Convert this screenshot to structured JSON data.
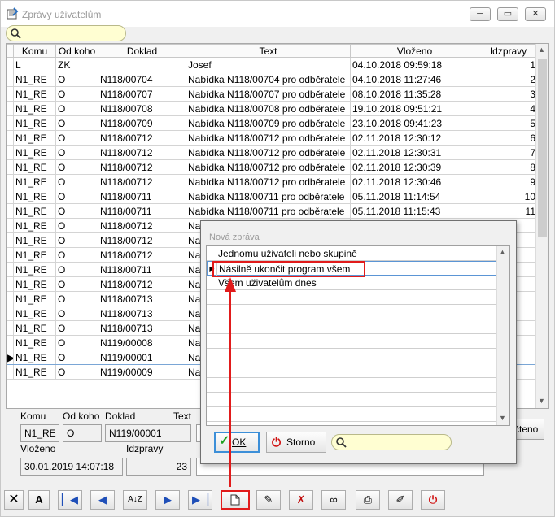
{
  "window": {
    "title": "Zprávy uživatelům"
  },
  "columns": [
    "Komu",
    "Od koho",
    "Doklad",
    "Text",
    "Vloženo",
    "Idzpravy"
  ],
  "rows": [
    [
      "L",
      "ZK",
      "",
      "Josef",
      "04.10.2018 09:59:18",
      "1"
    ],
    [
      "N1_RE",
      "O",
      "N118/00704",
      "Nabídka N118/00704 pro odběratele",
      "04.10.2018 11:27:46",
      "2"
    ],
    [
      "N1_RE",
      "O",
      "N118/00707",
      "Nabídka N118/00707 pro odběratele",
      "08.10.2018 11:35:28",
      "3"
    ],
    [
      "N1_RE",
      "O",
      "N118/00708",
      "Nabídka N118/00708 pro odběratele",
      "19.10.2018 09:51:21",
      "4"
    ],
    [
      "N1_RE",
      "O",
      "N118/00709",
      "Nabídka N118/00709 pro odběratele",
      "23.10.2018 09:41:23",
      "5"
    ],
    [
      "N1_RE",
      "O",
      "N118/00712",
      "Nabídka N118/00712 pro odběratele",
      "02.11.2018 12:30:12",
      "6"
    ],
    [
      "N1_RE",
      "O",
      "N118/00712",
      "Nabídka N118/00712 pro odběratele",
      "02.11.2018 12:30:31",
      "7"
    ],
    [
      "N1_RE",
      "O",
      "N118/00712",
      "Nabídka N118/00712 pro odběratele",
      "02.11.2018 12:30:39",
      "8"
    ],
    [
      "N1_RE",
      "O",
      "N118/00712",
      "Nabídka N118/00712 pro odběratele",
      "02.11.2018 12:30:46",
      "9"
    ],
    [
      "N1_RE",
      "O",
      "N118/00711",
      "Nabídka N118/00711 pro odběratele",
      "05.11.2018 11:14:54",
      "10"
    ],
    [
      "N1_RE",
      "O",
      "N118/00711",
      "Nabídka N118/00711 pro odběratele",
      "05.11.2018 11:15:43",
      "11"
    ],
    [
      "N1_RE",
      "O",
      "N118/00712",
      "Na",
      "",
      ""
    ],
    [
      "N1_RE",
      "O",
      "N118/00712",
      "Na",
      "",
      ""
    ],
    [
      "N1_RE",
      "O",
      "N118/00712",
      "Na",
      "",
      ""
    ],
    [
      "N1_RE",
      "O",
      "N118/00711",
      "Na",
      "",
      ""
    ],
    [
      "N1_RE",
      "O",
      "N118/00712",
      "Na",
      "",
      ""
    ],
    [
      "N1_RE",
      "O",
      "N118/00713",
      "Na",
      "",
      ""
    ],
    [
      "N1_RE",
      "O",
      "N118/00713",
      "Na",
      "",
      ""
    ],
    [
      "N1_RE",
      "O",
      "N118/00713",
      "Na",
      "",
      ""
    ],
    [
      "N1_RE",
      "O",
      "N119/00008",
      "Na",
      "",
      ""
    ],
    [
      "N1_RE",
      "O",
      "N119/00001",
      "Na",
      "",
      ""
    ],
    [
      "N1_RE",
      "O",
      "N119/00009",
      "Na",
      "",
      ""
    ]
  ],
  "selected_row_index": 20,
  "detail": {
    "label_komu": "Komu",
    "label_odkoho": "Od koho",
    "label_doklad": "Doklad",
    "label_text": "Text",
    "komu": "N1_RE",
    "odkoho": "O",
    "doklad": "N119/00001",
    "label_vlozeno": "Vloženo",
    "label_idzpravy": "Idzpravy",
    "vlozeno": "30.01.2019 14:07:18",
    "idzpravy": "23",
    "partial_button": "čteno"
  },
  "dialog": {
    "title": "Nová zpráva",
    "items": [
      "Jednomu uživateli nebo skupině",
      "Násilně ukončit program všem",
      "Všem uživatelům dnes"
    ],
    "selected_index": 1,
    "ok_label": "OK",
    "cancel_label": "Storno"
  },
  "toolbar": {
    "buttons": [
      "close-icon",
      "font-icon",
      "first-record-icon",
      "previous-record-icon",
      "sort-icon",
      "next-record-icon",
      "last-record-icon",
      "new-document-icon",
      "edit-icon",
      "delete-icon",
      "search-binoculars-icon",
      "print-icon",
      "tools-icon",
      "power-icon"
    ],
    "highlighted": "new-document-icon"
  },
  "colors": {
    "highlight": "#e11b1b",
    "search_bg": "#fffed2",
    "ok_border": "#3c8fd8"
  }
}
